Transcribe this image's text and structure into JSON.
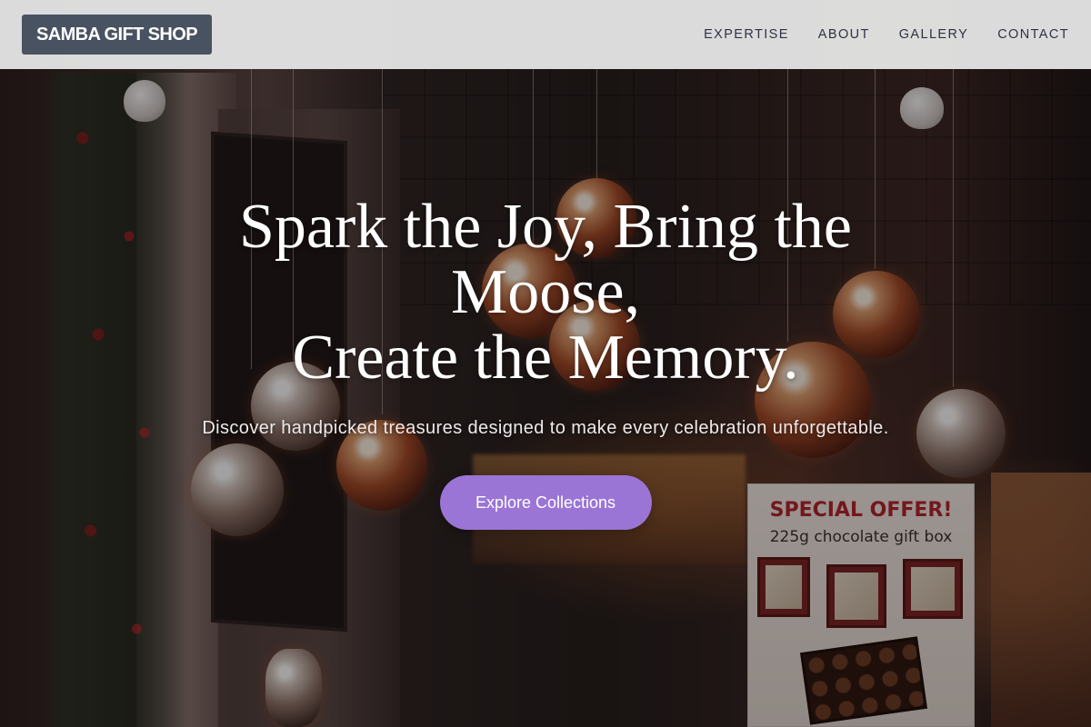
{
  "brand": {
    "name": "SAMBA GIFT SHOP"
  },
  "nav": {
    "items": [
      {
        "label": "EXPERTISE"
      },
      {
        "label": "ABOUT"
      },
      {
        "label": "GALLERY"
      },
      {
        "label": "CONTACT"
      }
    ]
  },
  "hero": {
    "headline_lines": [
      "Spark the Joy, Bring the Moose,",
      "Create the Memory."
    ],
    "subtitle": "Discover handpicked treasures designed to make every celebration unforgettable.",
    "cta_label": "Explore Collections",
    "background_sign": {
      "title": "SPECIAL OFFER!",
      "subtitle": "225g chocolate gift box"
    }
  },
  "colors": {
    "header_bg": "#e4e4e4",
    "logo_bg": "#495261",
    "nav_text": "#2d3340",
    "cta_bg": "#9a75d6",
    "headline": "#ffffff"
  }
}
